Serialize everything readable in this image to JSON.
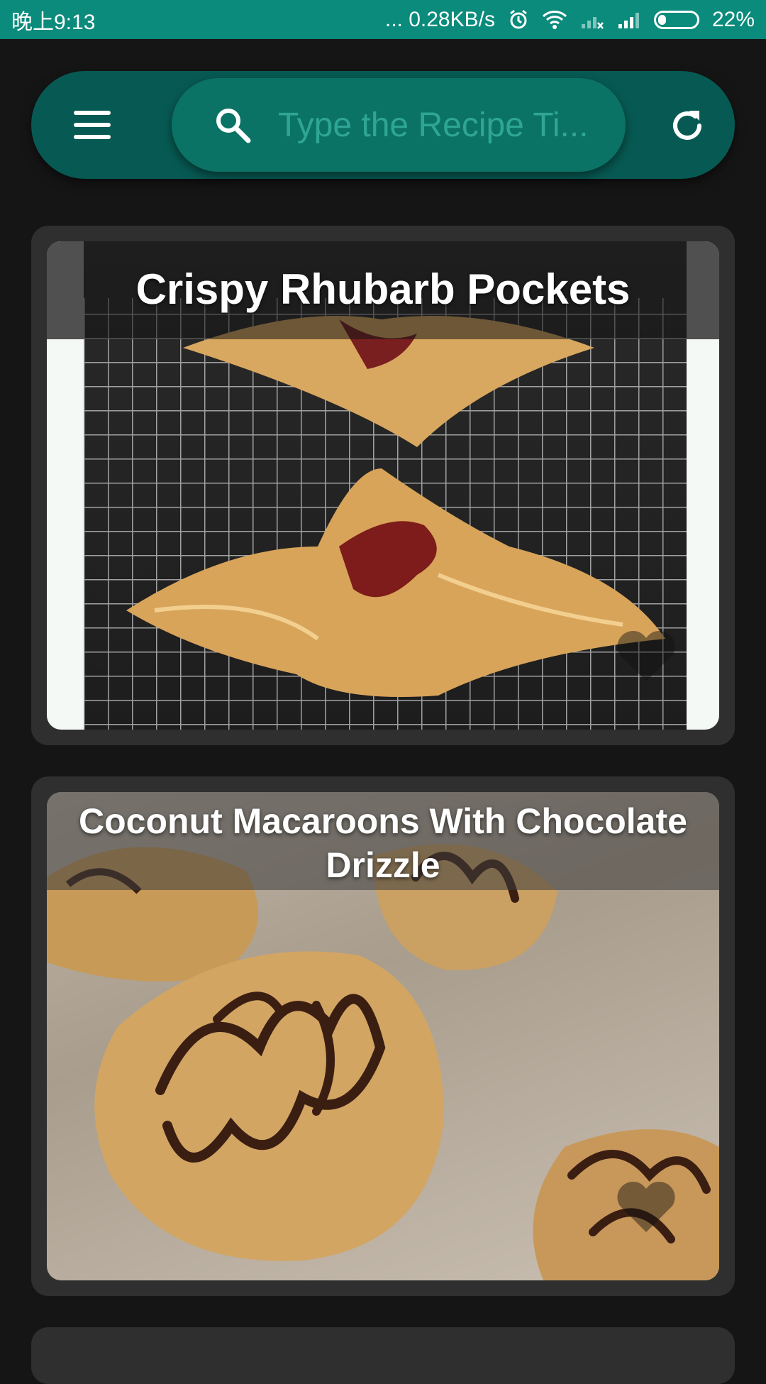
{
  "status_bar": {
    "time": "晚上9:13",
    "network_speed": "... 0.28KB/s",
    "battery_percent": "22%",
    "battery_level": 0.22
  },
  "toolbar": {
    "search_placeholder": "Type the Recipe Ti..."
  },
  "recipes": [
    {
      "title": "Crispy Rhubarb Pockets"
    },
    {
      "title": "Coconut Macaroons With Chocolate Drizzle"
    }
  ],
  "colors": {
    "status_bar": "#0a8b7c",
    "toolbar": "#075a53",
    "search_box": "#0b7266",
    "background": "#151515",
    "card": "#2f2f2f"
  },
  "icons": [
    "menu-icon",
    "search-icon",
    "refresh-icon",
    "heart-icon",
    "alarm-icon",
    "wifi-icon",
    "signal-icon",
    "battery-icon"
  ]
}
